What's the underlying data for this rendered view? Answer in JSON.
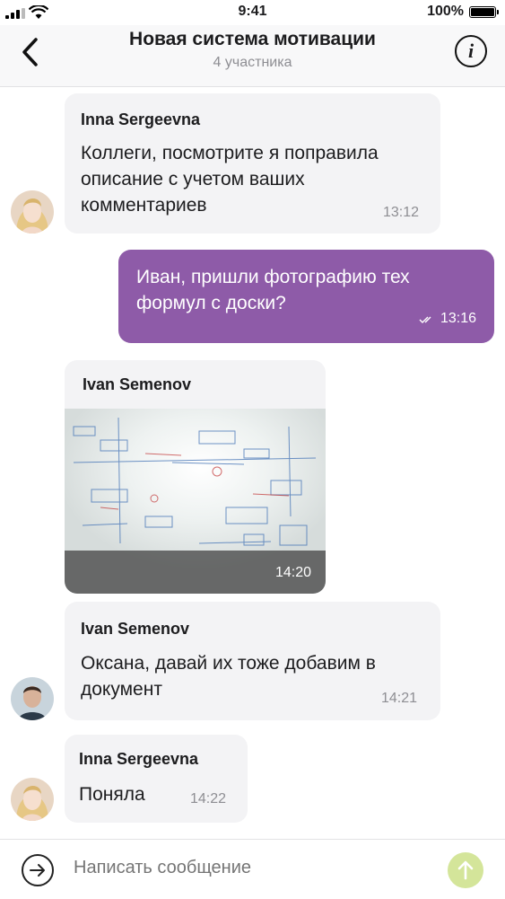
{
  "status_bar": {
    "time": "9:41",
    "battery": "100%",
    "icons": [
      "signal-icon",
      "wifi-icon",
      "battery-icon"
    ]
  },
  "header": {
    "title": "Новая система мотивации",
    "subtitle": "4 участника",
    "icons": [
      "back-arrow-icon",
      "info-icon"
    ]
  },
  "messages": [
    {
      "sender": "Inna Sergeevna",
      "lines": [
        "Коллеги, посмотрите я поправила",
        "описание с учетом ваших",
        "комментариев"
      ],
      "time": "13:12",
      "direction": "incoming"
    },
    {
      "lines": [
        "Иван, пришли фотографию тех",
        "формул с доски?"
      ],
      "time": "13:16",
      "direction": "outgoing",
      "status": "read"
    },
    {
      "sender": "Ivan Semenov",
      "type": "photo",
      "time": "14:20",
      "direction": "incoming"
    },
    {
      "sender": "Ivan Semenov",
      "lines": [
        "Оксана, давай их тоже добавим в",
        "документ"
      ],
      "time": "14:21",
      "direction": "incoming"
    },
    {
      "sender": "Inna Sergeevna",
      "lines": [
        "Поняла"
      ],
      "time": "14:22",
      "direction": "incoming"
    }
  ],
  "composer": {
    "placeholder": "Написать сообщение",
    "icons": [
      "attach-arrow-icon",
      "send-icon"
    ]
  },
  "colors": {
    "outgoing_bubble": "#8e5ba8",
    "incoming_bubble": "#f3f3f5",
    "send_button": "#d4e59a",
    "header_bg": "#f8f8f9"
  }
}
